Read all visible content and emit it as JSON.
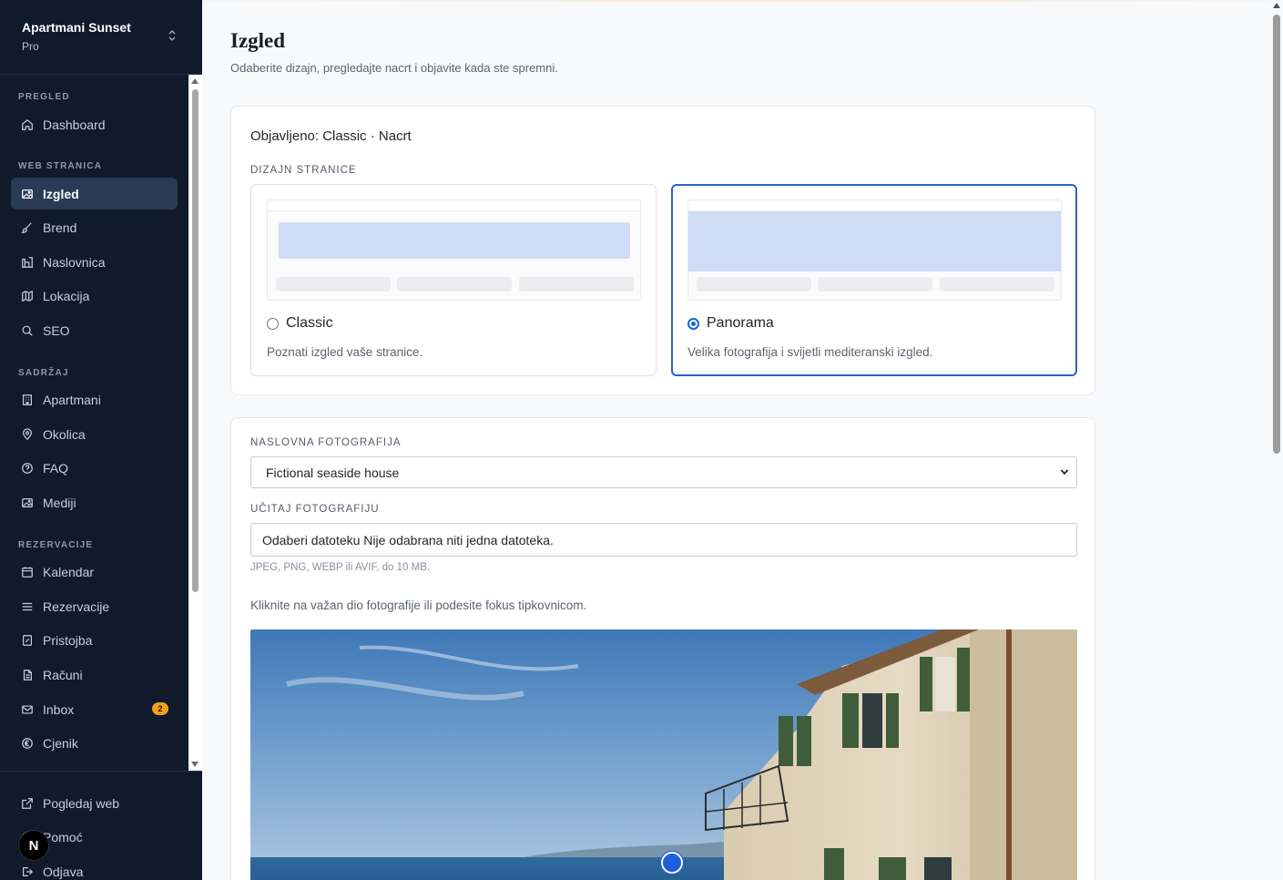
{
  "sidebar": {
    "brand": {
      "name": "Apartmani Sunset",
      "plan": "Pro"
    },
    "sections": {
      "overview": "PREGLED",
      "website": "WEB STRANICA",
      "content": "SADRŽAJ",
      "reservations": "REZERVACIJE"
    },
    "items": {
      "dashboard": "Dashboard",
      "izgled": "Izgled",
      "brend": "Brend",
      "naslovnica": "Naslovnica",
      "lokacija": "Lokacija",
      "seo": "SEO",
      "apartmani": "Apartmani",
      "okolica": "Okolica",
      "faq": "FAQ",
      "mediji": "Mediji",
      "kalendar": "Kalendar",
      "rezervacije": "Rezervacije",
      "pristojba": "Pristojba",
      "racuni": "Računi",
      "inbox": "Inbox",
      "cjenik": "Cjenik"
    },
    "inbox_badge": "2",
    "footer": {
      "view_web": "Pogledaj web",
      "help": "Pomoć",
      "logout": "Odjava"
    },
    "avatar_letter": "N",
    "active_item": "izgled"
  },
  "page": {
    "title": "Izgled",
    "subtitle": "Odaberite dizajn, pregledajte nacrt i objavite kada ste spremni."
  },
  "design_card": {
    "status_prefix": "Objavljeno:",
    "status_value": "Classic · Nacrt",
    "label": "DIZAJN STRANICE",
    "options": [
      {
        "name": "Classic",
        "description": "Poznati izgled vaše stranice.",
        "selected": false
      },
      {
        "name": "Panorama",
        "description": "Velika fotografija i svijetli mediteranski izgled.",
        "selected": true
      }
    ]
  },
  "photo_card": {
    "cover_label": "NASLOVNA FOTOGRAFIJA",
    "cover_value": "Fictional seaside house",
    "upload_label": "UČITAJ FOTOGRAFIJU",
    "upload_value": "Odaberi datoteku Nije odabrana niti jedna datoteka.",
    "upload_hint": "JPEG, PNG, WEBP ili AVIF, do 10 MB.",
    "instruction": "Kliknite na važan dio fotografije ili podesite fokus tipkovnicom."
  },
  "colors": {
    "sidebar_bg": "#0f1a2b",
    "active_item_bg": "#2a3a55",
    "accent_blue": "#2a62c9",
    "badge": "#f0a020"
  }
}
